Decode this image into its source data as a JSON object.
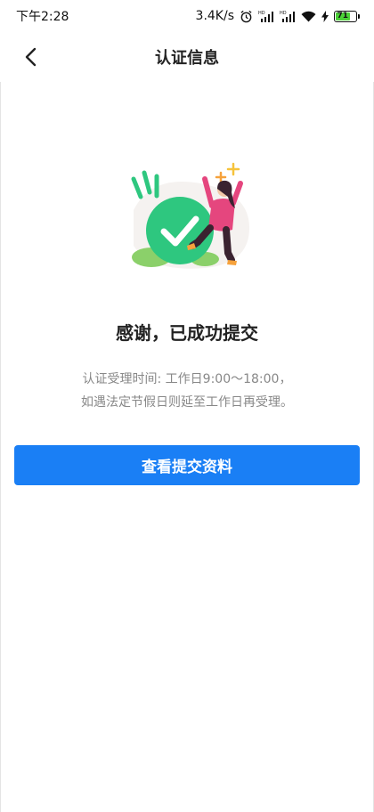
{
  "status_bar": {
    "time": "下午2:28",
    "network_speed": "3.4K/s",
    "icons": [
      "alarm-icon",
      "signal-hd-icon",
      "signal-hd-icon",
      "wifi-icon",
      "charging-icon"
    ],
    "battery_level": "71",
    "battery_fraction": 0.71
  },
  "nav": {
    "back_icon": "chevron-left-icon",
    "title": "认证信息"
  },
  "illustration": {
    "icon": "success-check-icon",
    "accent_color": "#2ec77f",
    "figure_color": "#e5467e"
  },
  "main": {
    "headline": "感谢，已成功提交",
    "desc_line1": "认证受理时间: 工作日9:00～18:00，",
    "desc_line2": "如遇法定节假日则延至工作日再受理。"
  },
  "actions": {
    "view_submission_label": "查看提交资料",
    "button_color": "#1a7ff5"
  }
}
